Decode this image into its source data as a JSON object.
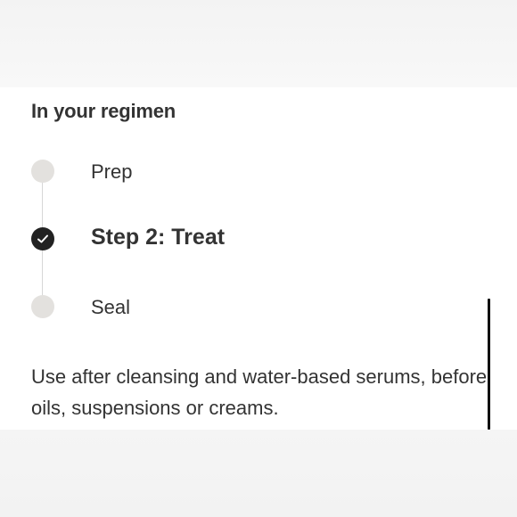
{
  "regimen": {
    "title": "In your regimen",
    "steps": [
      {
        "label": "Prep",
        "state": "inactive"
      },
      {
        "label": "Step 2: Treat",
        "state": "active"
      },
      {
        "label": "Seal",
        "state": "inactive"
      }
    ],
    "description": "Use after cleansing and water-based serums, before oils, suspensions or creams."
  },
  "colors": {
    "active_dot": "#222222",
    "inactive_dot": "#e3e1de",
    "rail": "#d7d7d7",
    "text": "#333333"
  },
  "icons": {
    "active_step": "check-icon"
  }
}
